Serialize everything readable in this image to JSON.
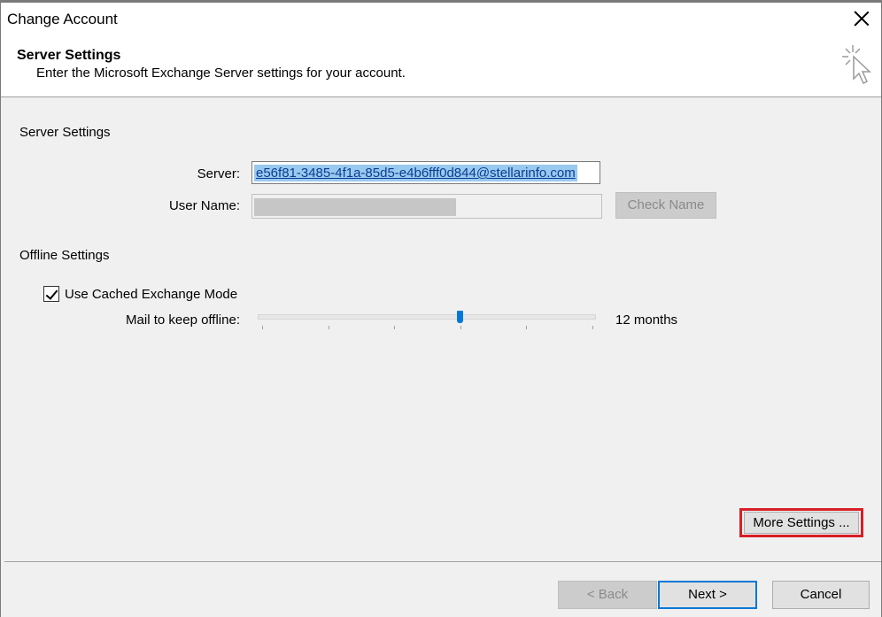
{
  "window": {
    "title": "Change Account"
  },
  "header": {
    "title": "Server Settings",
    "subtitle": "Enter the Microsoft Exchange Server settings for your account.",
    "icon": "cursor-sparkle-icon"
  },
  "server_settings": {
    "section_label": "Server Settings",
    "server_label": "Server:",
    "server_value": "e56f81-3485-4f1a-85d5-e4b6fff0d844@stellarinfo.com",
    "username_label": "User Name:",
    "check_name_label": "Check Name"
  },
  "offline_settings": {
    "section_label": "Offline Settings",
    "cached_mode_label": "Use Cached Exchange Mode",
    "cached_mode_checked": true,
    "slider_label": "Mail to keep offline:",
    "slider_value_text": "12 months",
    "slider_position_fraction": 0.6
  },
  "buttons": {
    "more_settings": "More Settings ...",
    "back": "< Back",
    "next": "Next >",
    "cancel": "Cancel"
  },
  "colors": {
    "selection": "#99c9ef",
    "slider_thumb": "#0078d7",
    "highlight_box": "#d81e26"
  }
}
